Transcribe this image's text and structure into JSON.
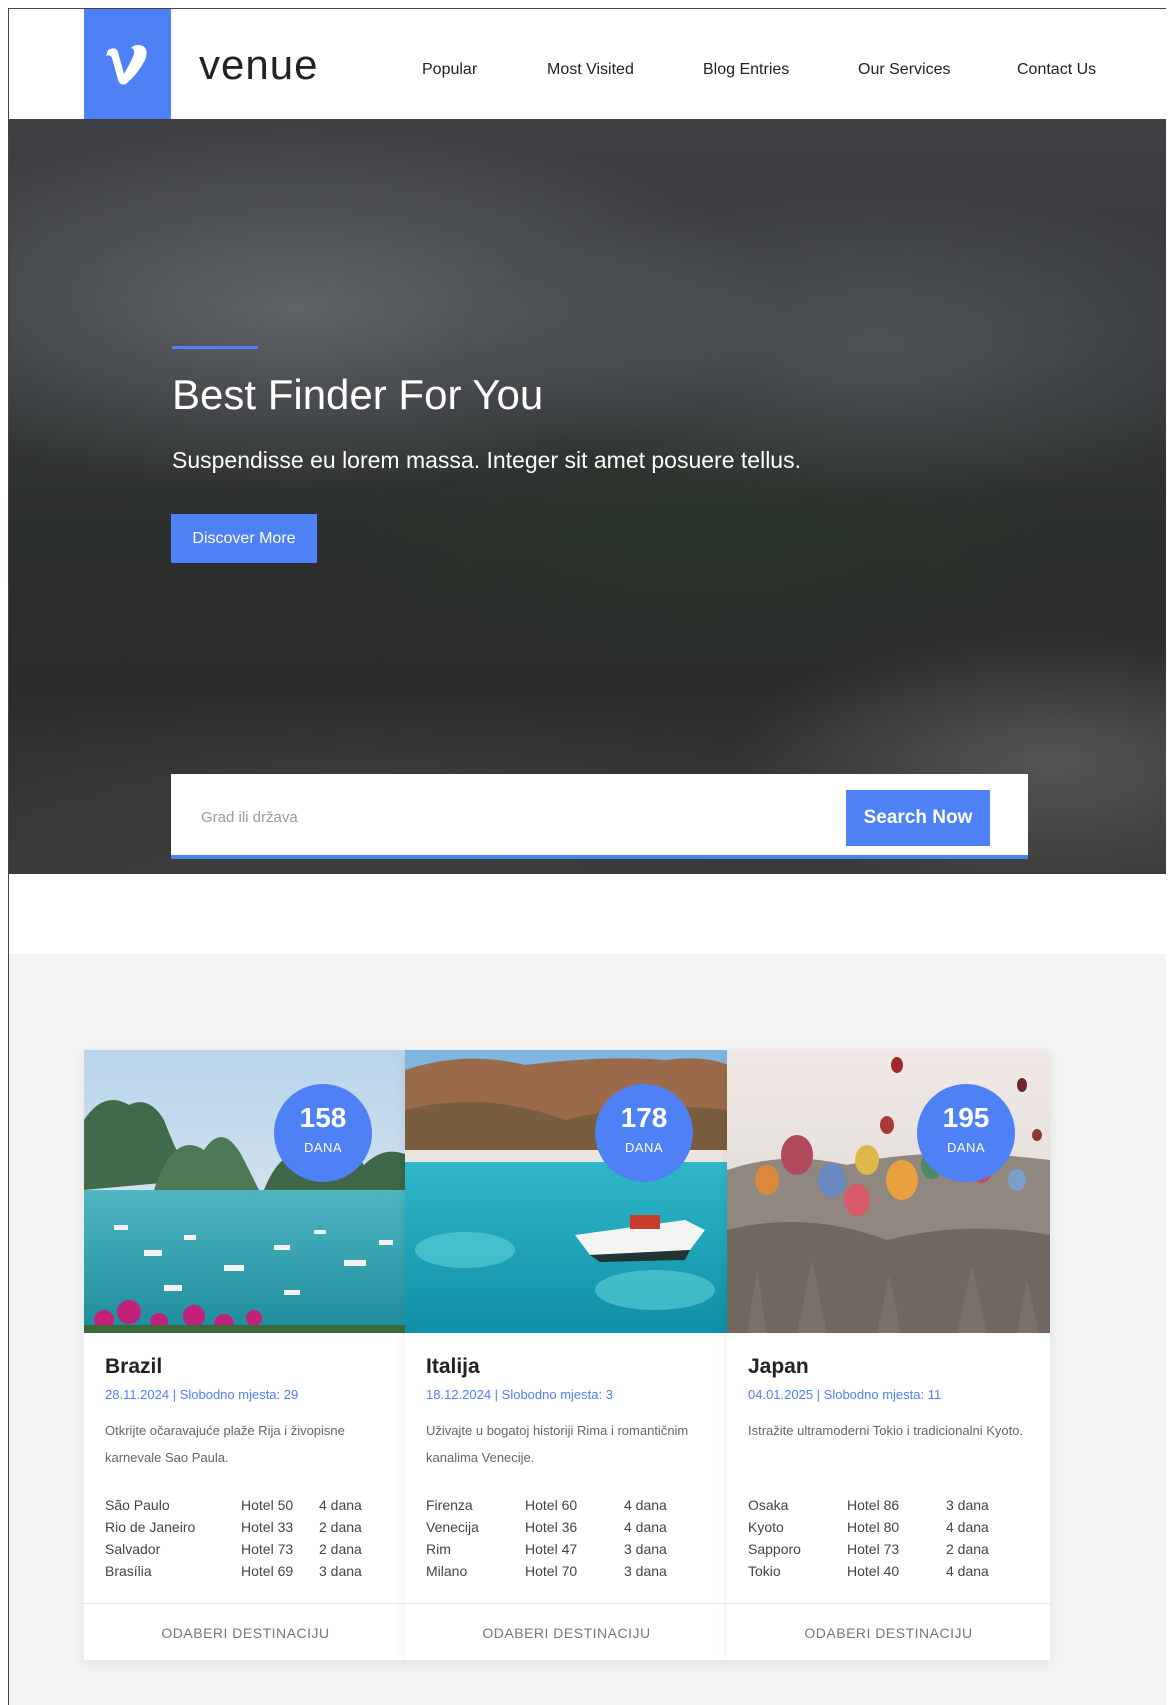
{
  "header": {
    "brand": "venue",
    "nav": [
      {
        "label": "Popular"
      },
      {
        "label": "Most Visited"
      },
      {
        "label": "Blog Entries"
      },
      {
        "label": "Our Services"
      },
      {
        "label": "Contact Us"
      }
    ]
  },
  "hero": {
    "title": "Best Finder For You",
    "subtitle": "Suspendisse eu lorem massa. Integer sit amet posuere tellus.",
    "button_label": "Discover More"
  },
  "search": {
    "placeholder": "Grad ili država",
    "button_label": "Search Now"
  },
  "colors": {
    "accent": "#4e80f6",
    "section_bg": "#f3f3f3"
  },
  "cards": [
    {
      "title": "Brazil",
      "meta": "28.11.2024 | Slobodno mjesta: 29",
      "description": "Otkrijte očaravajuće plaže Rija i živopisne karnevale Sao Paula.",
      "days_number": "158",
      "days_label": "DANA",
      "rows": [
        [
          "São Paulo",
          "Hotel 50",
          "4 dana"
        ],
        [
          "Rio de Janeiro",
          "Hotel 33",
          "2 dana"
        ],
        [
          "Salvador",
          "Hotel 73",
          "2 dana"
        ],
        [
          "Brasília",
          "Hotel 69",
          "3 dana"
        ]
      ],
      "footer": "ODABERI DESTINACIJU"
    },
    {
      "title": "Italija",
      "meta": "18.12.2024 | Slobodno mjesta: 3",
      "description": "Uživajte u bogatoj historiji Rima i romantičnim kanalima Venecije.",
      "days_number": "178",
      "days_label": "DANA",
      "rows": [
        [
          "Firenza",
          "Hotel 60",
          "4 dana"
        ],
        [
          "Venecija",
          "Hotel 36",
          "4 dana"
        ],
        [
          "Rim",
          "Hotel 47",
          "3 dana"
        ],
        [
          "Milano",
          "Hotel 70",
          "3 dana"
        ]
      ],
      "footer": "ODABERI DESTINACIJU"
    },
    {
      "title": "Japan",
      "meta": "04.01.2025 | Slobodno mjesta: 11",
      "description": "Istražite ultramoderni Tokio i tradicionalni Kyoto.",
      "days_number": "195",
      "days_label": "DANA",
      "rows": [
        [
          "Osaka",
          "Hotel 86",
          "3 dana"
        ],
        [
          "Kyoto",
          "Hotel 80",
          "4 dana"
        ],
        [
          "Sapporo",
          "Hotel 73",
          "2 dana"
        ],
        [
          "Tokio",
          "Hotel 40",
          "4 dana"
        ]
      ],
      "footer": "ODABERI DESTINACIJU"
    }
  ]
}
